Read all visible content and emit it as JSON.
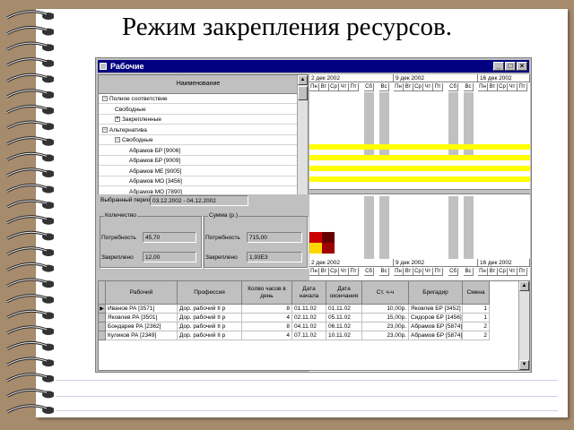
{
  "slide_title": "Режим закрепления ресурсов.",
  "window": {
    "title": "Рабочие",
    "buttons": [
      "_",
      "□",
      "×"
    ]
  },
  "tree": {
    "header": "Наименование",
    "rows": [
      {
        "label": "Полное соответствие",
        "toggle": "−"
      },
      {
        "label": "Свободные",
        "toggle": ""
      },
      {
        "label": "Закрепленные",
        "toggle": "+"
      },
      {
        "label": "Альтернатива",
        "toggle": "−"
      },
      {
        "label": "Свободные",
        "toggle": "−"
      },
      {
        "label": "Абрамов БР [9006]",
        "toggle": ""
      },
      {
        "label": "Абрамов БР [9009]",
        "toggle": ""
      },
      {
        "label": "Абрамов МЕ [9005]",
        "toggle": ""
      },
      {
        "label": "Абрамов МО [3456]",
        "toggle": ""
      },
      {
        "label": "Абрамов МО [7890]",
        "toggle": ""
      }
    ]
  },
  "calendar": {
    "weeks": [
      "2 дек 2002",
      "9 дек 2002",
      "16 дек 2002"
    ],
    "days": [
      "Пн",
      "Вт",
      "Ср",
      "Чт",
      "Пт",
      "Сб",
      "Вс"
    ]
  },
  "filters": {
    "period_label": "Выбранный период",
    "period_value": "03.12.2002 - 04.12.2002",
    "quantity": {
      "title": "Количество",
      "need_label": "Потребность",
      "need_value": "45,70",
      "fixed_label": "Закреплено",
      "fixed_value": "12,00"
    },
    "sum": {
      "title": "Сумма (р.)",
      "need_label": "Потребность",
      "need_value": "715,00",
      "fixed_label": "Закреплено",
      "fixed_value": "1,93Е3"
    }
  },
  "table": {
    "columns": [
      "Рабочий",
      "Профессия",
      "Колво часов в день",
      "Дата начала",
      "Дата окончания",
      "Ст. ч-ч",
      "Бригадир",
      "Смена"
    ],
    "rows": [
      [
        "Иванов РА [3571]",
        "Дор. рабочий II р",
        "8",
        "01.11.02",
        "01.11.02",
        "10,00р.",
        "Яковлев БР [3452]",
        "1"
      ],
      [
        "Яковлев РА [3501]",
        "Дор. рабочий II р",
        "4",
        "02.11.02",
        "05.11.02",
        "15,00р.",
        "Сидоров БР [1456]",
        "1"
      ],
      [
        "Бондарев РА [2362]",
        "Дор. рабочий II р",
        "8",
        "04.11.02",
        "06.11.02",
        "23,00р.",
        "Абрамов БР [5874]",
        "2"
      ],
      [
        "Куликов РА [2349]",
        "Дор. рабочий II р",
        "4",
        "07.11.02",
        "10.11.02",
        "23,00р.",
        "Абрамов БР [5874]",
        "2"
      ]
    ]
  },
  "colors": {
    "titlebar": "#000080",
    "bar_yellow": "#ffff00",
    "cell_red": "#cc0000",
    "cell_dark": "#660000",
    "cell_yellow": "#ffd700",
    "paper_bg": "#a68b6d"
  }
}
